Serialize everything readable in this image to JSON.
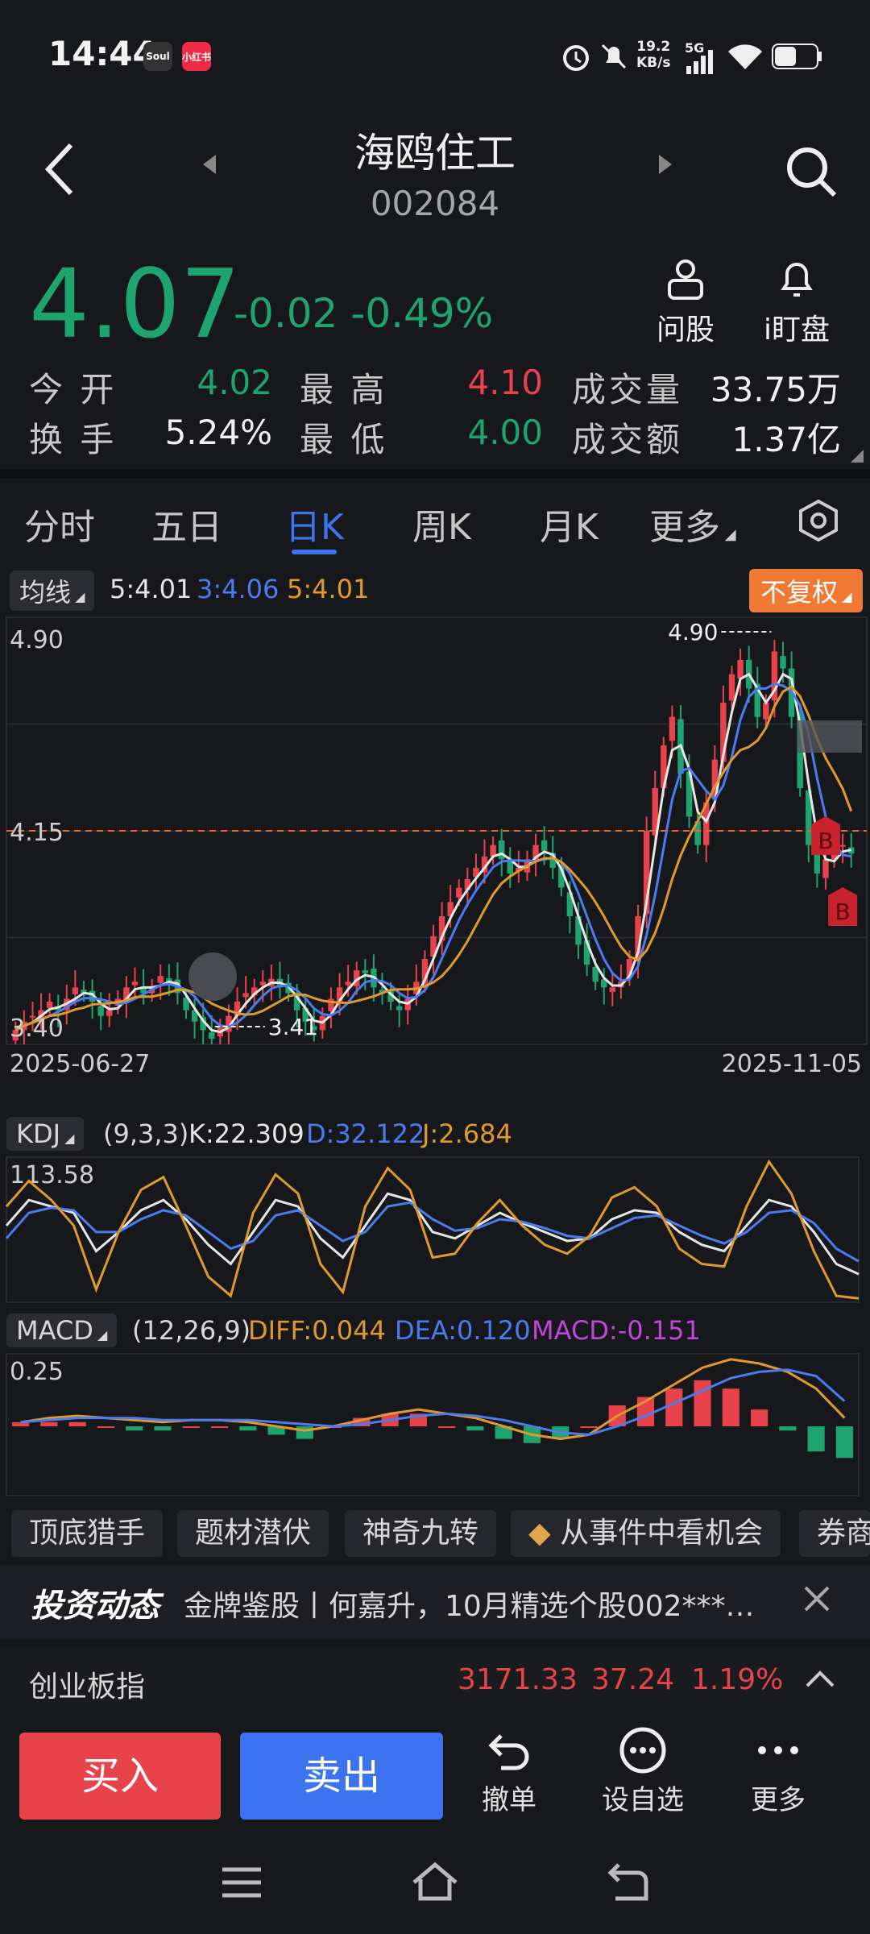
{
  "status": {
    "time": "14:44",
    "app1": "Soul",
    "app2": "小红书",
    "speed": "19.2",
    "speed_unit": "KB/s",
    "network": "5G"
  },
  "header": {
    "name": "海鸥住工",
    "code": "002084"
  },
  "price": {
    "last": "4.07",
    "change": "-0.02",
    "change_pct": "-0.49%"
  },
  "actions": {
    "ask": "问股",
    "watch": "i盯盘"
  },
  "quote": {
    "open_label": "今 开",
    "open": "4.02",
    "high_label": "最 高",
    "high": "4.10",
    "volume_label": "成交量",
    "volume": "33.75万",
    "turnover_label": "换 手",
    "turnover": "5.24%",
    "low_label": "最 低",
    "low": "4.00",
    "amount_label": "成交额",
    "amount": "1.37亿"
  },
  "tabs": [
    "分时",
    "五日",
    "日K",
    "周K",
    "月K",
    "更多"
  ],
  "active_tab": "日K",
  "ma": {
    "label": "均线",
    "ma5": "5:4.01",
    "ma3": "3:4.06",
    "ma5b": "5:4.01"
  },
  "adjust": "不复权",
  "kdj": {
    "label": "KDJ",
    "params": "(9,3,3)",
    "k": "K:22.309",
    "d": "D:32.122",
    "j": "J:2.684"
  },
  "macd": {
    "label": "MACD",
    "params": "(12,26,9)",
    "diff": "DIFF:0.044",
    "dea": "DEA:0.120",
    "macd": "MACD:-0.151"
  },
  "colors": {
    "up": "#e8434b",
    "down": "#1ea46e",
    "ma5": "#e6e6e6",
    "ma10": "#4a7cf0",
    "ma20": "#e09a2c",
    "accent": "#3c74f0"
  },
  "chart_data": [
    {
      "type": "candlestick",
      "title": "日K",
      "x_start": "2025-06-27",
      "x_end": "2025-11-05",
      "ylim": [
        3.4,
        4.9
      ],
      "y_ticks": [
        "4.90",
        "4.15",
        "3.40"
      ],
      "max_marker": "4.90",
      "min_marker": "3.41",
      "ref_line": "4.15",
      "closes": [
        3.45,
        3.48,
        3.5,
        3.52,
        3.55,
        3.52,
        3.56,
        3.6,
        3.58,
        3.55,
        3.5,
        3.52,
        3.56,
        3.6,
        3.62,
        3.58,
        3.6,
        3.64,
        3.62,
        3.58,
        3.52,
        3.48,
        3.45,
        3.42,
        3.46,
        3.5,
        3.55,
        3.58,
        3.6,
        3.62,
        3.63,
        3.6,
        3.58,
        3.52,
        3.48,
        3.45,
        3.5,
        3.56,
        3.6,
        3.62,
        3.66,
        3.65,
        3.6,
        3.58,
        3.55,
        3.52,
        3.56,
        3.62,
        3.7,
        3.78,
        3.85,
        3.9,
        3.95,
        3.98,
        4.02,
        4.06,
        4.1,
        4.05,
        4.0,
        4.02,
        4.05,
        4.1,
        4.08,
        4.02,
        3.95,
        3.85,
        3.75,
        3.68,
        3.62,
        3.6,
        3.6,
        3.62,
        3.7,
        3.85,
        4.15,
        4.3,
        4.45,
        4.55,
        4.35,
        4.2,
        4.1,
        4.25,
        4.4,
        4.6,
        4.7,
        4.75,
        4.65,
        4.55,
        4.6,
        4.78,
        4.72,
        4.55,
        4.3,
        4.1,
        4.0,
        4.05,
        4.08,
        4.1,
        4.07
      ],
      "volume_note": "",
      "markers": [
        "B",
        "B"
      ]
    },
    {
      "type": "line",
      "title": "KDJ",
      "ylim": [
        0,
        113.58
      ],
      "y_ticks": [
        "113.58"
      ],
      "series": [
        {
          "name": "K",
          "values": [
            60,
            80,
            75,
            70,
            40,
            55,
            72,
            80,
            65,
            45,
            30,
            55,
            80,
            75,
            50,
            35,
            60,
            85,
            80,
            55,
            50,
            60,
            70,
            62,
            55,
            48,
            50,
            65,
            72,
            70,
            55,
            45,
            40,
            60,
            80,
            75,
            55,
            30,
            22
          ]
        },
        {
          "name": "D",
          "values": [
            50,
            70,
            74,
            72,
            55,
            55,
            65,
            72,
            68,
            55,
            42,
            48,
            68,
            72,
            60,
            48,
            55,
            75,
            78,
            65,
            56,
            58,
            65,
            63,
            58,
            52,
            50,
            58,
            66,
            68,
            60,
            52,
            46,
            55,
            70,
            72,
            62,
            42,
            32
          ]
        },
        {
          "name": "J",
          "values": [
            75,
            95,
            80,
            60,
            10,
            55,
            88,
            98,
            60,
            20,
            5,
            70,
            100,
            85,
            30,
            8,
            75,
            105,
            88,
            35,
            38,
            62,
            80,
            60,
            45,
            38,
            52,
            82,
            90,
            75,
            42,
            30,
            28,
            75,
            110,
            85,
            40,
            5,
            3
          ]
        }
      ]
    },
    {
      "type": "bar",
      "title": "MACD",
      "y_ticks": [
        "0.25"
      ],
      "series": [
        {
          "name": "DIFF",
          "values": [
            0.02,
            0.04,
            0.05,
            0.04,
            0.03,
            0.02,
            0.03,
            0.03,
            0.02,
            0.0,
            -0.02,
            0.0,
            0.03,
            0.06,
            0.08,
            0.06,
            0.04,
            0.0,
            -0.04,
            -0.06,
            -0.04,
            0.05,
            0.12,
            0.2,
            0.28,
            0.32,
            0.3,
            0.26,
            0.18,
            0.04
          ]
        },
        {
          "name": "DEA",
          "values": [
            0.02,
            0.03,
            0.04,
            0.04,
            0.04,
            0.03,
            0.03,
            0.03,
            0.03,
            0.02,
            0.01,
            0.0,
            0.01,
            0.03,
            0.05,
            0.06,
            0.05,
            0.03,
            0.0,
            -0.03,
            -0.04,
            0.0,
            0.05,
            0.11,
            0.17,
            0.23,
            0.26,
            0.27,
            0.24,
            0.12
          ]
        },
        {
          "name": "MACD",
          "values": [
            0.02,
            0.02,
            0.02,
            0.0,
            -0.02,
            -0.02,
            0.0,
            0.0,
            -0.02,
            -0.04,
            -0.06,
            0.0,
            0.04,
            0.06,
            0.06,
            0.0,
            -0.02,
            -0.06,
            -0.08,
            -0.06,
            0.0,
            0.1,
            0.14,
            0.18,
            0.22,
            0.18,
            0.08,
            -0.02,
            -0.12,
            -0.151
          ]
        }
      ]
    }
  ],
  "shortcuts": [
    "顶底猎手",
    "题材潜伏",
    "神奇九转",
    "从事件中看机会",
    "券商"
  ],
  "news": {
    "brand": "投资动态",
    "text": "金牌鉴股丨何嘉升，10月精选个股002***…"
  },
  "index": {
    "name": "创业板指",
    "value": "3171.33",
    "change": "37.24",
    "pct": "1.19%"
  },
  "trade": {
    "buy": "买入",
    "sell": "卖出",
    "cancel": "撤单",
    "fav": "设自选",
    "more": "更多"
  }
}
